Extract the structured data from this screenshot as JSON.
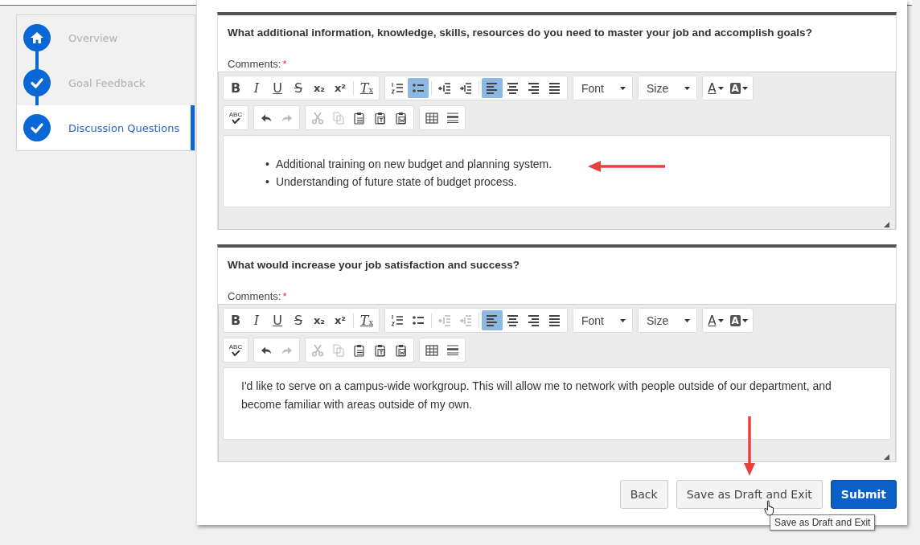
{
  "steps": [
    {
      "label": "Overview",
      "kind": "home",
      "selected": false
    },
    {
      "label": "Goal Feedback",
      "kind": "done",
      "selected": false
    },
    {
      "label": "Discussion Questions",
      "kind": "done",
      "selected": true
    }
  ],
  "questions": [
    {
      "title": "What additional information, knowledge, skills, resources do you need to master your job and accomplish goals?",
      "comments_label": "Comments:",
      "required": "*",
      "toolbar": [
        [
          [
            {
              "kind": "bold",
              "glyph": "B"
            },
            {
              "kind": "italic",
              "glyph": "I"
            },
            {
              "kind": "underline",
              "glyph": "U"
            },
            {
              "kind": "strike",
              "glyph": "S"
            },
            {
              "kind": "sub",
              "glyph": "x₂"
            },
            {
              "kind": "sup",
              "glyph": "x²"
            },
            {
              "kind": "clear",
              "glyph": "T",
              "glyph_sub": "x",
              "sep": true
            }
          ],
          [
            {
              "kind": "ol",
              "on": false,
              "disabled": false
            },
            {
              "kind": "ul",
              "on": true,
              "disabled": false
            },
            {
              "kind": "outdent",
              "on": false,
              "disabled": false,
              "sep": true
            },
            {
              "kind": "indent",
              "on": false,
              "disabled": false
            },
            {
              "kind": "align-left",
              "on": true,
              "sep": true
            },
            {
              "kind": "align-center",
              "on": false
            },
            {
              "kind": "align-right",
              "on": false
            },
            {
              "kind": "justify",
              "on": false
            }
          ],
          [
            {
              "kind": "dropdown",
              "glyph": "Font"
            }
          ],
          [
            {
              "kind": "dropdown",
              "glyph": "Size"
            }
          ],
          [
            {
              "kind": "text-color",
              "glyph": "A"
            },
            {
              "kind": "bg-color",
              "glyph": "A"
            }
          ]
        ],
        [
          [
            {
              "kind": "spell",
              "glyph": "ABC"
            }
          ],
          [
            {
              "kind": "undo",
              "disabled": false
            },
            {
              "kind": "redo",
              "disabled": true
            }
          ],
          [
            {
              "kind": "cut",
              "disabled": true
            },
            {
              "kind": "copy",
              "disabled": true
            },
            {
              "kind": "paste",
              "disabled": false
            },
            {
              "kind": "paste-text",
              "disabled": false
            },
            {
              "kind": "paste-word",
              "disabled": false
            }
          ],
          [
            {
              "kind": "table"
            },
            {
              "kind": "hr"
            }
          ]
        ]
      ],
      "content": {
        "kind": "list",
        "items": [
          {
            "marker": "•",
            "text": "Additional training on new budget and planning system."
          },
          {
            "marker": "•",
            "text": "Understanding of future state of budget process."
          }
        ]
      }
    },
    {
      "title": "What would increase your job satisfaction and success?",
      "comments_label": "Comments:",
      "required": "*",
      "toolbar": [
        [
          [
            {
              "kind": "bold",
              "glyph": "B"
            },
            {
              "kind": "italic",
              "glyph": "I"
            },
            {
              "kind": "underline",
              "glyph": "U"
            },
            {
              "kind": "strike",
              "glyph": "S"
            },
            {
              "kind": "sub",
              "glyph": "x₂"
            },
            {
              "kind": "sup",
              "glyph": "x²"
            },
            {
              "kind": "clear",
              "glyph": "T",
              "glyph_sub": "x",
              "sep": true
            }
          ],
          [
            {
              "kind": "ol",
              "on": false,
              "disabled": false
            },
            {
              "kind": "ul",
              "on": false,
              "disabled": false
            },
            {
              "kind": "outdent",
              "on": false,
              "disabled": true,
              "sep": true
            },
            {
              "kind": "indent",
              "on": false,
              "disabled": true
            },
            {
              "kind": "align-left",
              "on": true,
              "sep": true
            },
            {
              "kind": "align-center",
              "on": false
            },
            {
              "kind": "align-right",
              "on": false
            },
            {
              "kind": "justify",
              "on": false
            }
          ],
          [
            {
              "kind": "dropdown",
              "glyph": "Font"
            }
          ],
          [
            {
              "kind": "dropdown",
              "glyph": "Size"
            }
          ],
          [
            {
              "kind": "text-color",
              "glyph": "A"
            },
            {
              "kind": "bg-color",
              "glyph": "A"
            }
          ]
        ],
        [
          [
            {
              "kind": "spell",
              "glyph": "ABC"
            }
          ],
          [
            {
              "kind": "undo",
              "disabled": false
            },
            {
              "kind": "redo",
              "disabled": true
            }
          ],
          [
            {
              "kind": "cut",
              "disabled": true
            },
            {
              "kind": "copy",
              "disabled": true
            },
            {
              "kind": "paste",
              "disabled": false
            },
            {
              "kind": "paste-text",
              "disabled": false
            },
            {
              "kind": "paste-word",
              "disabled": false
            }
          ],
          [
            {
              "kind": "table"
            },
            {
              "kind": "hr"
            }
          ]
        ]
      ],
      "content": {
        "kind": "paragraph",
        "text": "I'd like to serve on a campus-wide workgroup. This will allow me to network with people outside of our department, and become familiar with areas outside of my own."
      }
    }
  ],
  "buttons": [
    {
      "label": "Back",
      "kind": "default"
    },
    {
      "label": "Save as Draft and Exit",
      "kind": "default"
    },
    {
      "label": "Submit",
      "kind": "primary"
    }
  ],
  "tooltip": "Save as Draft and Exit"
}
